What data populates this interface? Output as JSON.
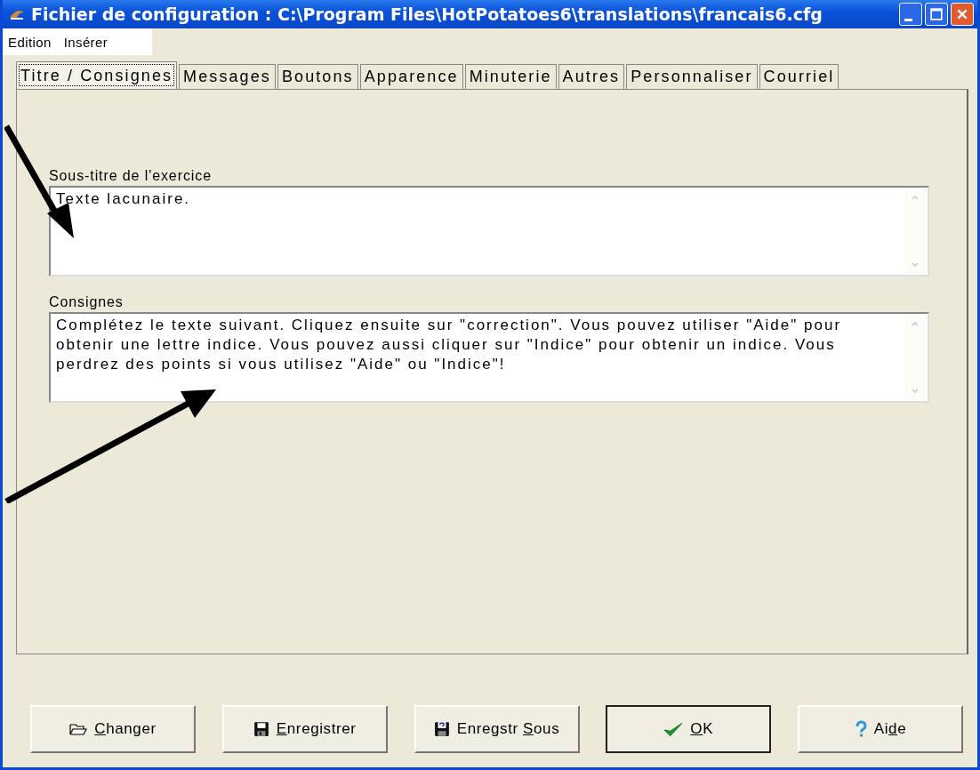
{
  "window": {
    "title": "Fichier de configuration : C:\\Program Files\\HotPotatoes6\\translations\\francais6.cfg"
  },
  "menu": [
    "Edition",
    "Insérer"
  ],
  "tabs": [
    {
      "label": "Titre / Consignes",
      "selected": true
    },
    {
      "label": "Messages",
      "selected": false
    },
    {
      "label": "Boutons",
      "selected": false
    },
    {
      "label": "Apparence",
      "selected": false
    },
    {
      "label": "Minuterie",
      "selected": false
    },
    {
      "label": "Autres",
      "selected": false
    },
    {
      "label": "Personnaliser",
      "selected": false
    },
    {
      "label": "Courriel",
      "selected": false
    }
  ],
  "fields": [
    {
      "label": "Sous-titre de l'exercice",
      "value": "Texte lacunaire."
    },
    {
      "label": "Consignes",
      "value": "Complétez le texte suivant. Cliquez ensuite sur \"correction\". Vous pouvez utiliser \"Aide\" pour obtenir une lettre indice. Vous pouvez aussi cliquer sur  \"Indice\" pour obtenir un indice. Vous perdrez des points si vous utilisez \"Aide\" ou \"Indice\"!"
    }
  ],
  "buttons": [
    {
      "kind": "open",
      "key": "C",
      "after": "hanger",
      "default": false
    },
    {
      "kind": "save",
      "key": "E",
      "after": "nregistrer",
      "default": false
    },
    {
      "kind": "saveas",
      "before": "Enregstr ",
      "key": "S",
      "after": "ous",
      "default": false
    },
    {
      "kind": "ok",
      "key": "O",
      "after": "K",
      "default": true
    },
    {
      "kind": "help",
      "before": "Ai",
      "key": "d",
      "after": "e",
      "default": false
    }
  ]
}
